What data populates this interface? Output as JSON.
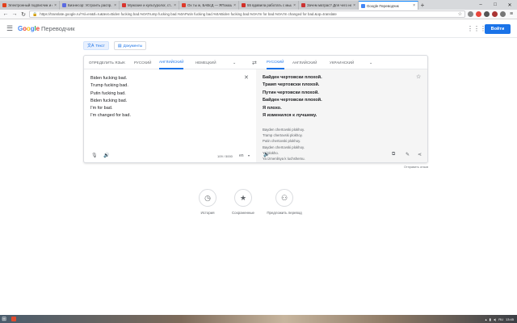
{
  "browser": {
    "tabs": [
      {
        "title": "Электронный подписчик и с...",
        "color": "#e2401c"
      },
      {
        "title": "Бизнесор: Устроить распр...",
        "color": "#5b6be0"
      },
      {
        "title": "Мужские и культуролог, ст...",
        "color": "#d9352f"
      },
      {
        "title": "Ох ты ж, БАВсД — ЯПоказать ...",
        "color": "#de3a2a"
      },
      {
        "title": "55 вдавила работать с мыш...",
        "color": "#d22f27"
      },
      {
        "title": "Зачем матрас? Для чего нет...",
        "color": "#cc3333"
      },
      {
        "title": "Google Переводчик",
        "color": "#4285f4"
      }
    ],
    "new_tab": "+",
    "url": "https://translate.google.ru/?sl=en&tl=ru&text=Biden fucking bad.%0ATrump fucking bad.%0APutin fucking bad.%0ABiden fucking bad.%0AI'm for bad.%0AI'm changed for bad.&op=translate"
  },
  "header": {
    "logo_parts": [
      "G",
      "o",
      "o",
      "g",
      "l",
      "e"
    ],
    "product": "Переводчик",
    "signin": "Войти"
  },
  "modes": [
    {
      "icon": "文A",
      "label": "Текст"
    },
    {
      "icon": "▤",
      "label": "Документы"
    }
  ],
  "source_langs": [
    "ОПРЕДЕЛИТЬ ЯЗЫК",
    "РУССКИЙ",
    "АНГЛИЙСКИЙ",
    "НЕМЕЦКИЙ"
  ],
  "target_langs": [
    "РУССКИЙ",
    "АНГЛИЙСКИЙ",
    "УКРАИНСКИЙ"
  ],
  "source_text": [
    "Biden fucking bad.",
    "Trump fucking bad.",
    "Putin fucking bad.",
    "Biden fucking bad.",
    "I'm for bad.",
    "I'm changed for bad."
  ],
  "char_count": "109 / 5000",
  "keyboard_label": "en",
  "target_text": [
    "Байден чертовски плохой.",
    "Трамп чертовски плохой.",
    "Путин чертовски плохой.",
    "Байден чертовски плохой.",
    "Я плохо.",
    "Я изменился к лучшему."
  ],
  "transliteration": [
    "Bayden chertovski plokhoy.",
    "Tramp chertovski plokhoy.",
    "Putin chertovski plokhoy.",
    "Bayden chertovski plokhoy.",
    "Ya plokho.",
    "Ya izmenilsya k luchshemu."
  ],
  "feedback": "Отправить отзыв",
  "actions": [
    {
      "icon": "◷",
      "label": "История"
    },
    {
      "icon": "★",
      "label": "Сохраненные"
    },
    {
      "icon": "⚇",
      "label": "Предложить перевод"
    }
  ],
  "taskbar": {
    "clock": "13:45",
    "lang": "RU"
  }
}
